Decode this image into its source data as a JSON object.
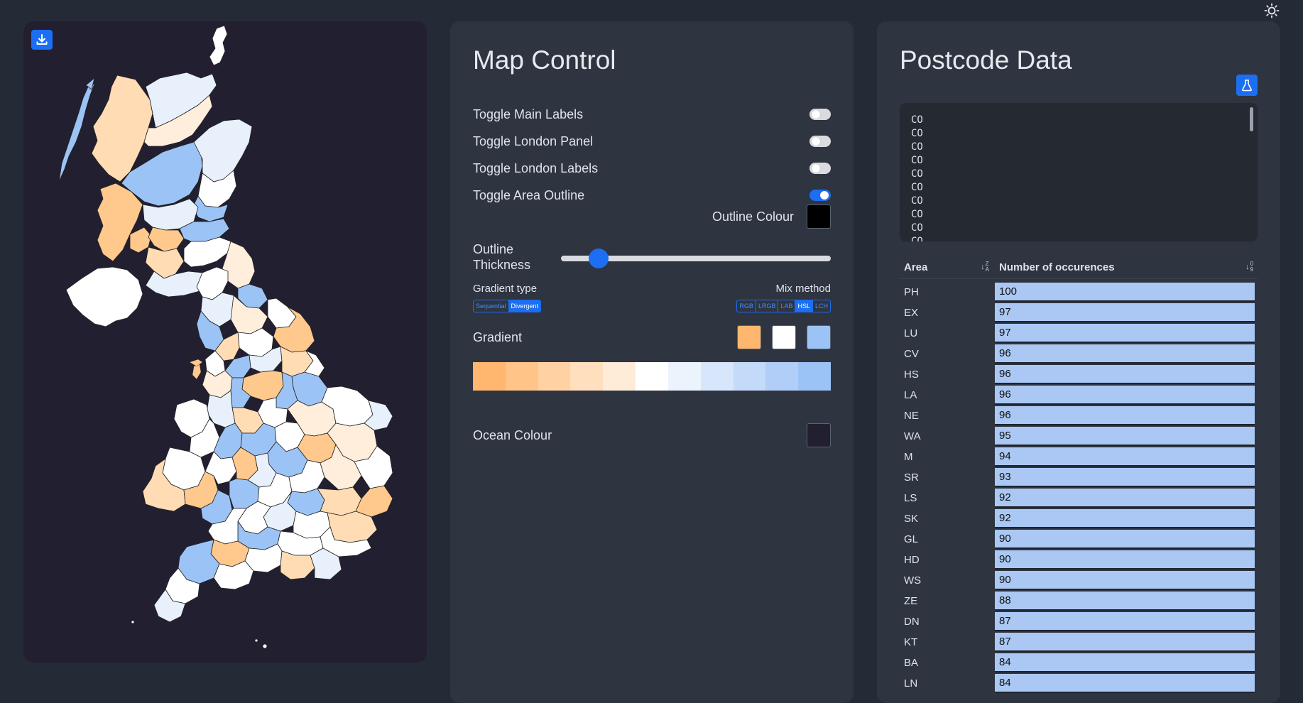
{
  "map_panel": {
    "download_icon": "download-icon"
  },
  "control": {
    "title": "Map Control",
    "toggles": [
      {
        "label": "Toggle Main Labels",
        "on": false
      },
      {
        "label": "Toggle London Panel",
        "on": false
      },
      {
        "label": "Toggle London Labels",
        "on": false
      },
      {
        "label": "Toggle Area Outline",
        "on": true
      }
    ],
    "outline_colour_label": "Outline Colour",
    "outline_colour": "#000000",
    "thickness_label": "Outline Thickness",
    "thickness_value": 0.14,
    "gradient_type_label": "Gradient type",
    "gradient_types": [
      "Sequential",
      "Divergent"
    ],
    "gradient_type_selected": "Divergent",
    "mix_method_label": "Mix method",
    "mix_methods": [
      "RGB",
      "LRGB",
      "LAB",
      "HSL",
      "LCH"
    ],
    "mix_method_selected": "HSL",
    "gradient_label": "Gradient",
    "gradient_colors": [
      "#ffb66e",
      "#ffffff",
      "#9cc3f5"
    ],
    "gradient_steps": [
      "#ffb66e",
      "#ffc488",
      "#ffd1a3",
      "#ffdfbd",
      "#ffecd8",
      "#ffffff",
      "#ebf3fd",
      "#d7e6fb",
      "#c4daf9",
      "#b0cef7",
      "#9cc3f5"
    ],
    "ocean_colour_label": "Ocean Colour",
    "ocean_colour": "#221f31"
  },
  "data": {
    "title": "Postcode Data",
    "flask_icon": "flask-icon",
    "codes": [
      "CO",
      "CO",
      "CO",
      "CO",
      "CO",
      "CO",
      "CO",
      "CO",
      "CO",
      "CO"
    ],
    "table_headers": {
      "area": "Area",
      "count": "Number of occurences",
      "area_sort": "Z A",
      "count_sort": "0 9"
    },
    "rows": [
      {
        "area": "PH",
        "count": "100"
      },
      {
        "area": "EX",
        "count": "97"
      },
      {
        "area": "LU",
        "count": "97"
      },
      {
        "area": "CV",
        "count": "96"
      },
      {
        "area": "HS",
        "count": "96"
      },
      {
        "area": "LA",
        "count": "96"
      },
      {
        "area": "NE",
        "count": "96"
      },
      {
        "area": "WA",
        "count": "95"
      },
      {
        "area": "M",
        "count": "94"
      },
      {
        "area": "SR",
        "count": "93"
      },
      {
        "area": "LS",
        "count": "92"
      },
      {
        "area": "SK",
        "count": "92"
      },
      {
        "area": "GL",
        "count": "90"
      },
      {
        "area": "HD",
        "count": "90"
      },
      {
        "area": "WS",
        "count": "90"
      },
      {
        "area": "ZE",
        "count": "88"
      },
      {
        "area": "DN",
        "count": "87"
      },
      {
        "area": "KT",
        "count": "87"
      },
      {
        "area": "BA",
        "count": "84"
      },
      {
        "area": "LN",
        "count": "84"
      }
    ]
  },
  "theme_icon": "sun-icon"
}
